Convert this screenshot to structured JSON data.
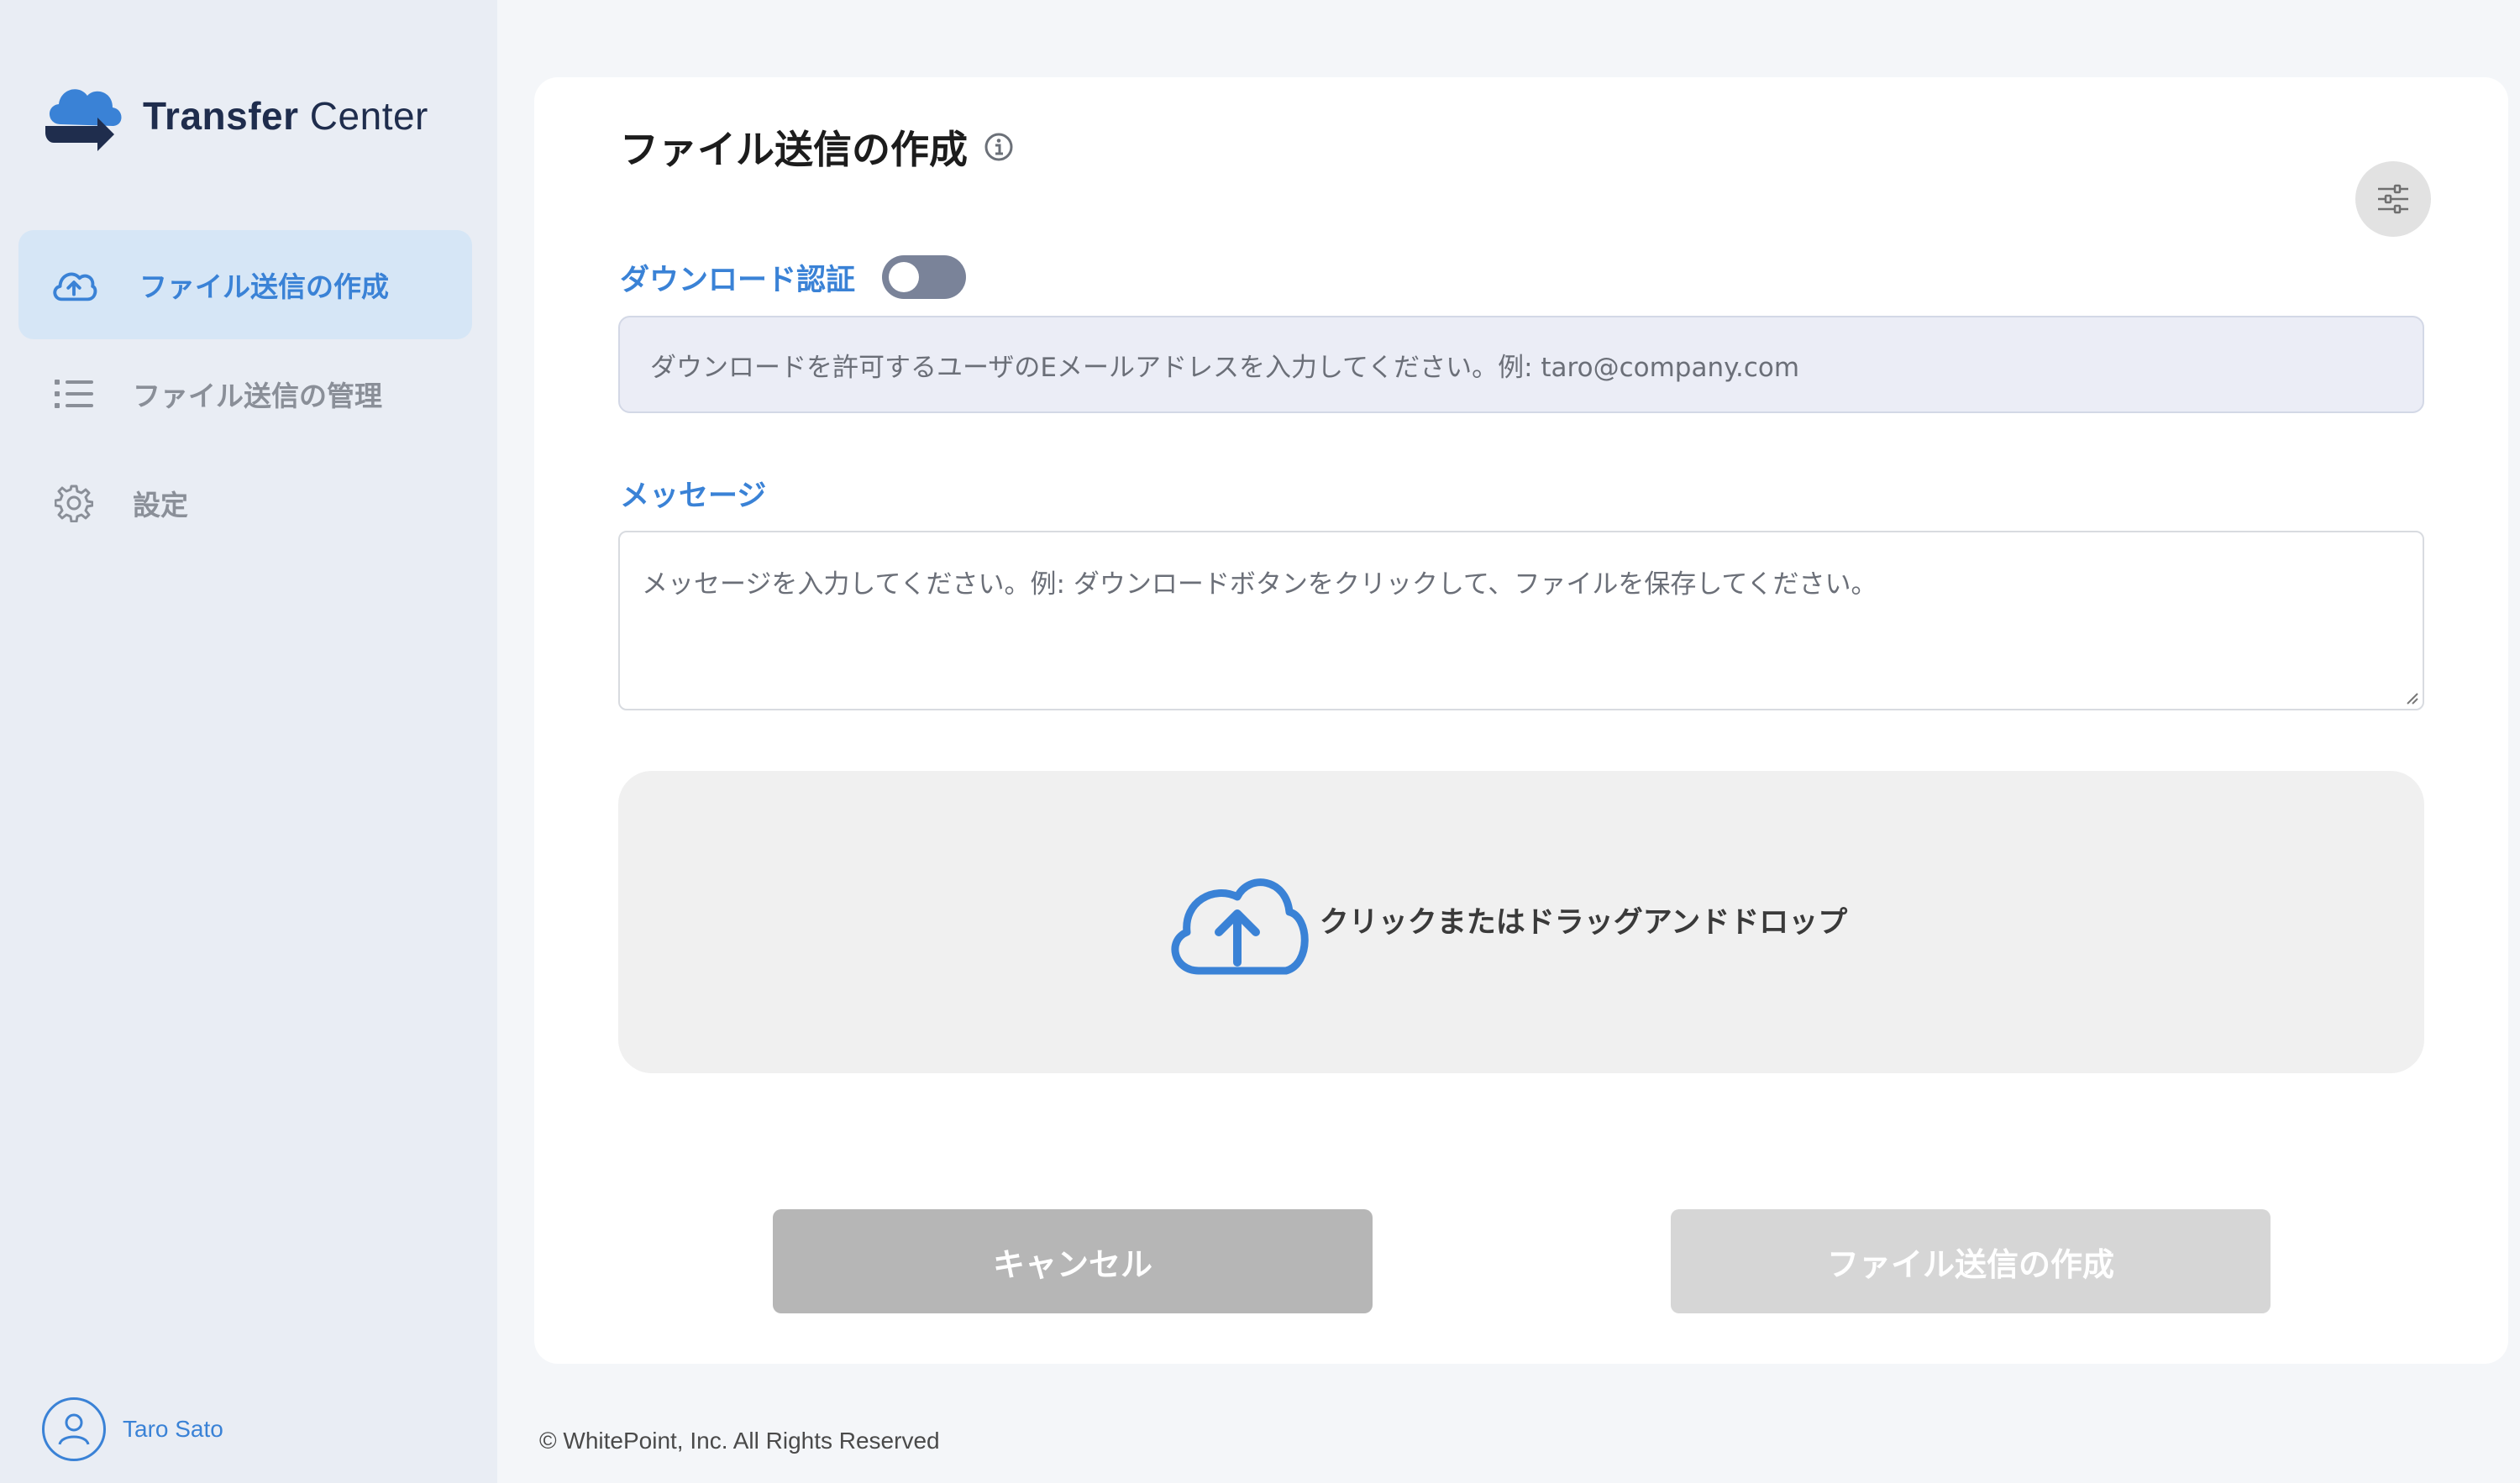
{
  "app": {
    "brand_bold": "Transfer",
    "brand_light": " Center"
  },
  "sidebar": {
    "items": [
      {
        "label": "ファイル送信の作成",
        "icon": "cloud-upload-icon",
        "active": true
      },
      {
        "label": "ファイル送信の管理",
        "icon": "list-icon",
        "active": false
      },
      {
        "label": "設定",
        "icon": "gear-icon",
        "active": false
      }
    ],
    "user_name": "Taro Sato"
  },
  "main": {
    "title": "ファイル送信の作成",
    "download_auth": {
      "label": "ダウンロード認証",
      "enabled": false,
      "placeholder": "ダウンロードを許可するユーザのEメールアドレスを入力してください。例: taro@company.com"
    },
    "message": {
      "label": "メッセージ",
      "placeholder": "メッセージを入力してください。例: ダウンロードボタンをクリックして、ファイルを保存してください。"
    },
    "dropzone_text": "クリックまたはドラッグアンドドロップ",
    "cancel_label": "キャンセル",
    "create_label": "ファイル送信の作成"
  },
  "footer": {
    "copyright": "© WhitePoint, Inc. All Rights Reserved"
  },
  "colors": {
    "accent": "#3a82d6",
    "brand_dark": "#1f2d4d",
    "sidebar_bg": "#e9edf4",
    "active_bg": "#d6e6f6"
  }
}
